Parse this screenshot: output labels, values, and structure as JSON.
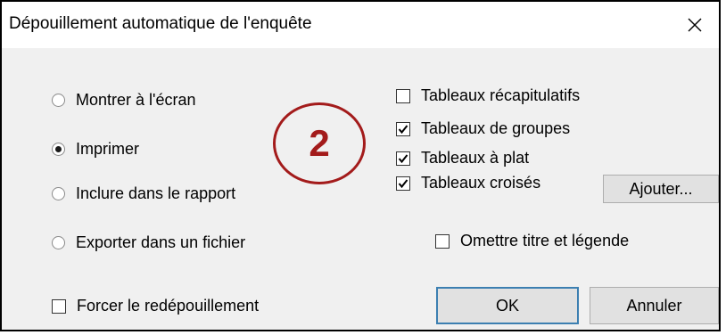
{
  "window": {
    "title": "Dépouillement automatique de l'enquête",
    "close_icon": "close-icon"
  },
  "output_options": [
    {
      "label": "Montrer à l'écran",
      "checked": false
    },
    {
      "label": "Imprimer",
      "checked": true
    },
    {
      "label": "Inclure dans le rapport",
      "checked": false
    },
    {
      "label": "Exporter dans un fichier",
      "checked": false
    }
  ],
  "table_options": [
    {
      "label": "Tableaux récapitulatifs",
      "checked": false
    },
    {
      "label": "Tableaux de groupes",
      "checked": true
    },
    {
      "label": "Tableaux à plat",
      "checked": true
    },
    {
      "label": "Tableaux croisés",
      "checked": true
    }
  ],
  "ajouter_label": "Ajouter...",
  "omit_title": {
    "label": "Omettre titre et légende",
    "checked": false
  },
  "force_recount": {
    "label": "Forcer le redépouillement",
    "checked": false
  },
  "ok_label": "OK",
  "cancel_label": "Annuler",
  "step_badge": "2",
  "colors": {
    "badge": "#a31b1b",
    "default_button_border": "#3c7fb1"
  }
}
